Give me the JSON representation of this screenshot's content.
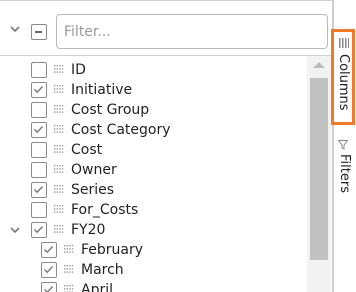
{
  "filter": {
    "placeholder": "Filter..."
  },
  "columns": [
    {
      "label": "ID",
      "checked": false,
      "level": 0,
      "group": false
    },
    {
      "label": "Initiative",
      "checked": true,
      "level": 0,
      "group": false
    },
    {
      "label": "Cost Group",
      "checked": false,
      "level": 0,
      "group": false
    },
    {
      "label": "Cost Category",
      "checked": true,
      "level": 0,
      "group": false
    },
    {
      "label": "Cost",
      "checked": false,
      "level": 0,
      "group": false
    },
    {
      "label": "Owner",
      "checked": false,
      "level": 0,
      "group": false
    },
    {
      "label": "Series",
      "checked": true,
      "level": 0,
      "group": false
    },
    {
      "label": "For_Costs",
      "checked": false,
      "level": 0,
      "group": false
    },
    {
      "label": "FY20",
      "checked": true,
      "level": 0,
      "group": true,
      "expanded": true
    },
    {
      "label": "February",
      "checked": true,
      "level": 1,
      "group": false
    },
    {
      "label": "March",
      "checked": true,
      "level": 1,
      "group": false
    },
    {
      "label": "April",
      "checked": true,
      "level": 1,
      "group": false
    }
  ],
  "side_tabs": {
    "columns_label": "Columns",
    "filters_label": "Filters",
    "accent_color": "#f07a2a"
  },
  "icons": {
    "header_toggle": "chevron-down-icon",
    "select_all": "indeterminate-checkbox",
    "drag_handle": "grip-icon",
    "columns_tab": "columns-icon",
    "filters_tab": "filter-icon"
  }
}
